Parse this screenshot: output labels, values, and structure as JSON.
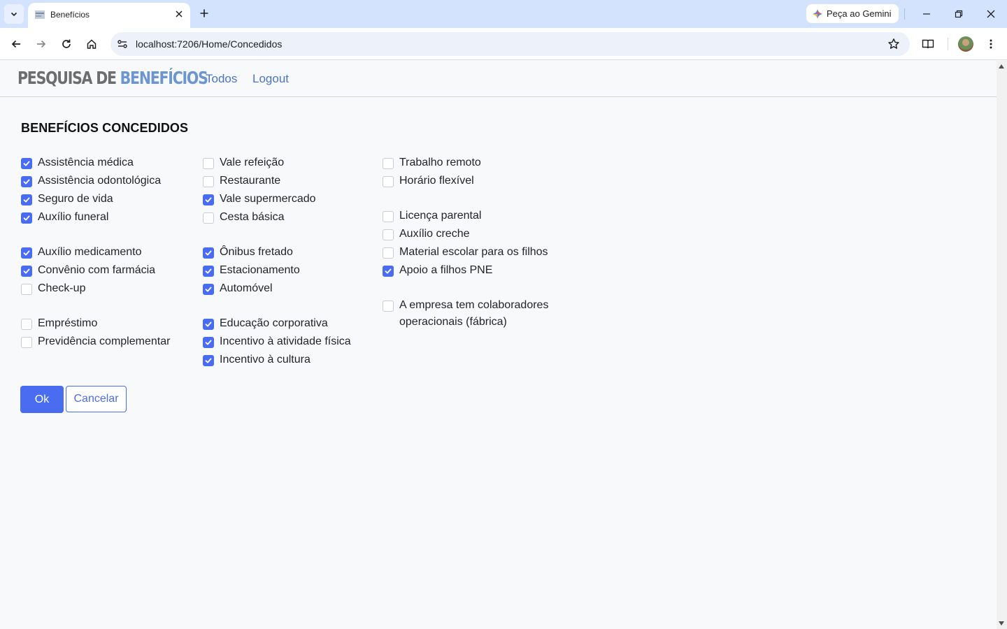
{
  "browser": {
    "tab_title": "Benefícios",
    "url": "localhost:7206/Home/Concedidos",
    "gemini_label": "Peça ao Gemini"
  },
  "site": {
    "brand_part1": "PESQUISA DE ",
    "brand_part2": "BENEFÍCIOS",
    "nav": [
      "Todos",
      "Logout"
    ]
  },
  "page": {
    "title": "BENEFÍCIOS CONCEDIDOS",
    "ok_label": "Ok",
    "cancel_label": "Cancelar"
  },
  "benefits": {
    "col1": [
      {
        "label": "Assistência médica",
        "checked": true
      },
      {
        "label": "Assistência odontológica",
        "checked": true
      },
      {
        "label": "Seguro de vida",
        "checked": true
      },
      {
        "label": "Auxílio funeral",
        "checked": true
      },
      {
        "label": "Auxílio medicamento",
        "checked": true
      },
      {
        "label": "Convênio com farmácia",
        "checked": true
      },
      {
        "label": "Check-up",
        "checked": false
      },
      {
        "label": "Empréstimo",
        "checked": false
      },
      {
        "label": "Previdência complementar",
        "checked": false
      }
    ],
    "col2": [
      {
        "label": "Vale refeição",
        "checked": false
      },
      {
        "label": "Restaurante",
        "checked": false
      },
      {
        "label": "Vale supermercado",
        "checked": true
      },
      {
        "label": "Cesta básica",
        "checked": false
      },
      {
        "label": "Ônibus fretado",
        "checked": true
      },
      {
        "label": "Estacionamento",
        "checked": true
      },
      {
        "label": "Automóvel",
        "checked": true
      },
      {
        "label": "Educação corporativa",
        "checked": true
      },
      {
        "label": "Incentivo à atividade física",
        "checked": true
      },
      {
        "label": "Incentivo à cultura",
        "checked": true
      }
    ],
    "col3": [
      {
        "label": "Trabalho remoto",
        "checked": false
      },
      {
        "label": "Horário flexível",
        "checked": false
      },
      {
        "label": "Licença parental",
        "checked": false
      },
      {
        "label": "Auxílio creche",
        "checked": false
      },
      {
        "label": "Material escolar para os filhos",
        "checked": false
      },
      {
        "label": "Apoio a filhos PNE",
        "checked": true
      },
      {
        "label": "A empresa tem colaboradores operacionais (fábrica)",
        "checked": false
      }
    ]
  },
  "colors": {
    "accent": "#4a6cf0",
    "link": "#4b73c4",
    "tabstrip": "#d3e3fd"
  }
}
